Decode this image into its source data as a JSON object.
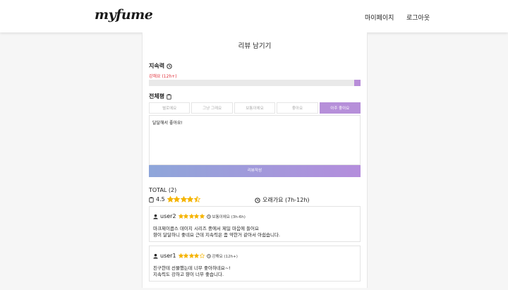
{
  "header": {
    "logo": "myfume",
    "nav": {
      "mypage": "마이페이지",
      "logout": "로그아웃"
    }
  },
  "form": {
    "title": "리뷰 남기기",
    "duration": {
      "label": "지속력",
      "value_label": "강해요 (12h+)",
      "level_fraction": 0.03
    },
    "overall": {
      "label": "전체평",
      "options": [
        "별로에요",
        "그냥 그래요",
        "보통이에요",
        "좋아요",
        "아주 좋아요"
      ],
      "selected": "아주 좋아요"
    },
    "textarea_value": "달달해서 좋아요!",
    "submit_label": "리뷰작성"
  },
  "summary": {
    "total": "TOTAL (2)",
    "avg_rating": "4.5",
    "avg_stars": 4.5,
    "duration_label": "오래가요 (7h-12h)"
  },
  "reviews": [
    {
      "user": "user2",
      "stars": 5,
      "duration": "보통이에요 (3h-6h)",
      "lines": [
        "마크제이콥스 데이지 시리즈 중에서 제일 마음에 들어요",
        "향이 달달하니 좋네요 근데 지속력은 좀 약한거 같아서 아쉽습니다."
      ]
    },
    {
      "user": "user1",
      "stars": 4,
      "duration": "강해요 (12h+)",
      "lines": [
        "친구한테 선물했는데 너무 좋아하네요~!",
        "지속력도 강하고 향이 너무 좋습니다."
      ]
    }
  ],
  "colors": {
    "accent": "#b68fd9",
    "star": "#f5b400",
    "danger": "#e0303a"
  },
  "icons": {
    "duration": "clock-icon",
    "overall": "clipboard-icon",
    "user": "user-icon"
  }
}
